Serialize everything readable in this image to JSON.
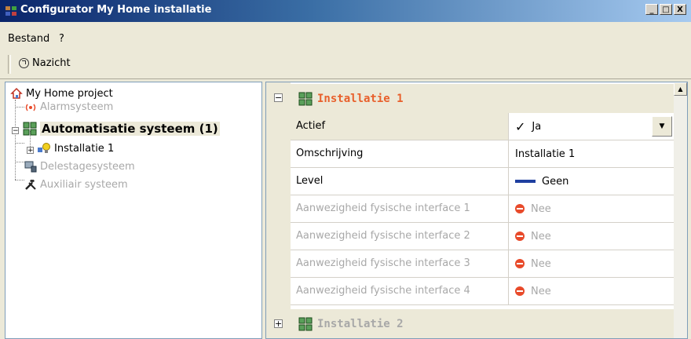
{
  "window": {
    "title": "Configurator My Home installatie",
    "buttons": [
      "_",
      "□",
      "X"
    ]
  },
  "menu": {
    "items": [
      "Bestand",
      "?"
    ]
  },
  "toolbar": {
    "nazicht_label": "Nazicht"
  },
  "tree": {
    "root": "My Home project",
    "items": [
      "Alarmsysteem",
      "Automatisatie systeem (1)",
      "Installatie 1",
      "Delestagesysteem",
      "Auxiliair systeem"
    ]
  },
  "grid": {
    "category1": "Installatie 1",
    "category2": "Installatie 2",
    "rows": [
      {
        "name": "Actief",
        "value": "Ja"
      },
      {
        "name": "Omschrijving",
        "value": "Installatie 1"
      },
      {
        "name": "Level",
        "value": "Geen"
      },
      {
        "name": "Aanwezigheid fysische interface 1",
        "value": "Nee"
      },
      {
        "name": "Aanwezigheid fysische interface 2",
        "value": "Nee"
      },
      {
        "name": "Aanwezigheid fysische interface 3",
        "value": "Nee"
      },
      {
        "name": "Aanwezigheid fysische interface 4",
        "value": "Nee"
      }
    ]
  },
  "colors": {
    "category_accent": "#e8602c",
    "disabled": "#a8a8a8",
    "level_bar": "#1f3fa0"
  }
}
